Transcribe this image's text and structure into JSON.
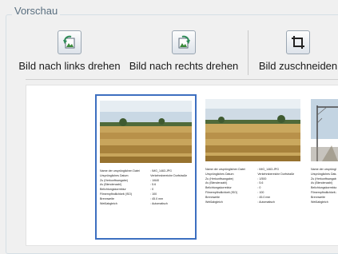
{
  "group": {
    "title": "Vorschau"
  },
  "toolbar": {
    "rotate_left": {
      "label": "Bild nach links drehen",
      "icon": "rotate-left-icon"
    },
    "rotate_right": {
      "label": "Bild nach rechts drehen",
      "icon": "rotate-right-icon"
    },
    "crop": {
      "label": "Bild zuschneiden",
      "icon": "crop-icon"
    }
  },
  "colors": {
    "selection": "#3d6fc0",
    "accent_green": "#3a8a3a"
  },
  "thumbnails": [
    {
      "selected": true,
      "rows": [
        {
          "k": "Name der ursprünglichen Datei",
          "v": ": IMG_1463.JPG"
        },
        {
          "k": "Ursprüngliches Datum",
          "v": "Verkehrsbereiche Dorfstraße"
        },
        {
          "k": "Zu (Herkunftsangabe)",
          "v": ": 1/640"
        },
        {
          "k": "Av (Blendenzahl)",
          "v": ": 5.6"
        },
        {
          "k": "Belichtungskorrektur",
          "v": ": 0"
        },
        {
          "k": "Filmempfindlichkeit (ISO)",
          "v": ": 100"
        },
        {
          "k": "Brennweite",
          "v": ": 45.0 mm"
        },
        {
          "k": "Weißabgleich",
          "v": ": Automatisch"
        }
      ]
    },
    {
      "selected": false,
      "rows": [
        {
          "k": "Name der ursprünglichen Datei",
          "v": ": IMG_1463.JPG"
        },
        {
          "k": "Ursprüngliches Datum",
          "v": "Verkehrsbereiche Dorfstraße"
        },
        {
          "k": "Zu (Herkunftsangabe)",
          "v": ": 1/500"
        },
        {
          "k": "Av (Blendenzahl)",
          "v": ": 5.6"
        },
        {
          "k": "Belichtungskorrektur",
          "v": ": 0"
        },
        {
          "k": "Filmempfindlichkeit (ISO)",
          "v": ": 100"
        },
        {
          "k": "Brennweite",
          "v": ": 45.0 mm"
        },
        {
          "k": "Weißabgleich",
          "v": ": Automatisch"
        }
      ]
    },
    {
      "selected": false,
      "rows": [
        {
          "k": "Name der ursprünglichen Datei",
          "v": ""
        },
        {
          "k": "Ursprüngliches Datum",
          "v": ""
        },
        {
          "k": "Zu (Herkunftsangabe)",
          "v": ""
        },
        {
          "k": "Av (Blendenzahl)",
          "v": ""
        },
        {
          "k": "Belichtungskorrektur",
          "v": ""
        },
        {
          "k": "Filmempfindlichkeit (ISO)",
          "v": ""
        },
        {
          "k": "Brennweite",
          "v": ""
        },
        {
          "k": "Weißabgleich",
          "v": ""
        }
      ]
    }
  ]
}
